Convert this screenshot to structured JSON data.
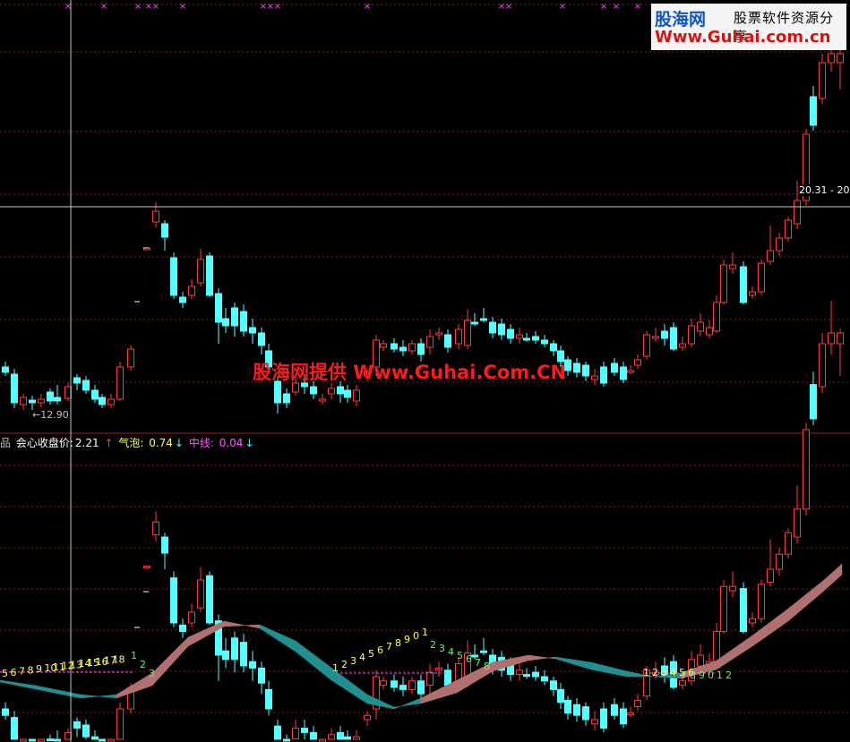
{
  "logo": {
    "brand": "股海网",
    "tagline": "股票软件资源分享",
    "url": "Www.Guhai.com.cn"
  },
  "watermark": "股海网提供 Www.Guhai.Com.CN",
  "price_tag": "20.31 - 20",
  "low_label": "←12.90",
  "legend": {
    "prefix": "品",
    "close_label": "会心收盘价:",
    "close_value": "2.21",
    "close_arrow": "↑",
    "bubble_label": "气泡:",
    "bubble_value": "0.74",
    "bubble_arrow": "↓",
    "mid_label": "中线:",
    "mid_value": "0.04",
    "mid_arrow": "↓"
  },
  "colors": {
    "up": "#ff3b3b",
    "down": "#54ffff",
    "band_up": "#b07070",
    "band_down": "#1f8f8f",
    "grid": "#8b1a1a",
    "crosshair": "#c8c8c8",
    "marker": "#ff44ff",
    "count_yellow": "#ffff55",
    "count_green": "#55ff55"
  },
  "chart_data": {
    "type": "candlestick",
    "panels": [
      "price",
      "indicator"
    ],
    "low_marker": 12.9,
    "crosshair_price": 20.31,
    "series": [
      {
        "name": "candles",
        "count": 62
      }
    ],
    "count_sequences": [
      {
        "labels": [
          "5",
          "6",
          "7",
          "8",
          "9",
          "10",
          "11",
          "12",
          "13",
          "14",
          "15",
          "16",
          "17",
          "18"
        ],
        "color": "yellow"
      },
      {
        "labels": [
          "1",
          "2",
          "3"
        ],
        "color": "green"
      },
      {
        "labels": [
          "1",
          "2",
          "3",
          "4",
          "5",
          "6",
          "7",
          "8",
          "9",
          "0",
          "1"
        ],
        "color": "yellow"
      },
      {
        "labels": [
          "2",
          "3",
          "4",
          "5",
          "6",
          "7",
          "8"
        ],
        "color": "green"
      },
      {
        "labels": [
          "1",
          "2",
          "3",
          "4",
          "5",
          "6"
        ],
        "color": "yellow"
      },
      {
        "labels": [
          "7",
          "8",
          "9",
          "0",
          "1",
          "2"
        ],
        "color": "green"
      }
    ]
  }
}
